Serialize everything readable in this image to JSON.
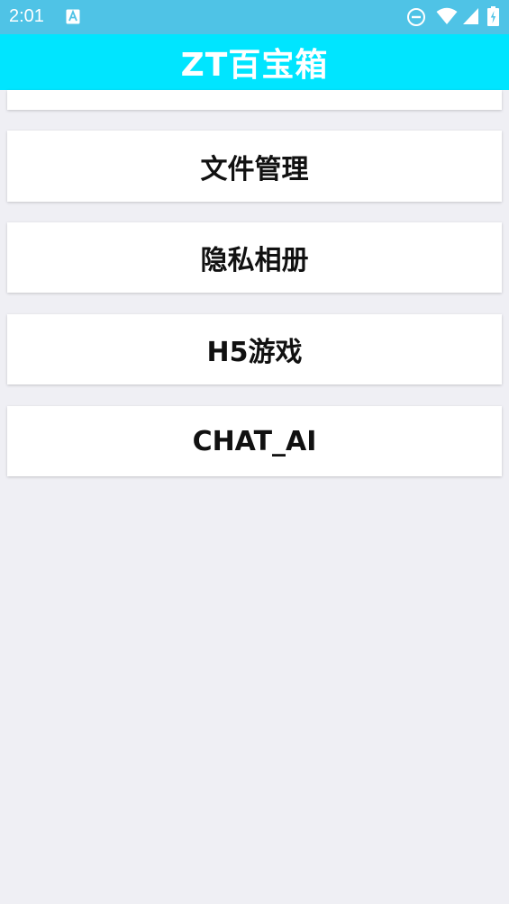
{
  "status_bar": {
    "time": "2:01",
    "icons": [
      "notification-a-icon",
      "do-not-disturb-icon",
      "wifi-icon",
      "cell-signal-icon",
      "battery-icon"
    ],
    "background": "#4fc3e6"
  },
  "app_bar": {
    "title": "ZT百宝箱",
    "background": "#00e5ff"
  },
  "menu": {
    "items": [
      {
        "label": "文件管理"
      },
      {
        "label": "隐私相册"
      },
      {
        "label": "H5游戏"
      },
      {
        "label": "CHAT_AI"
      }
    ]
  },
  "colors": {
    "page_background": "#efeff4",
    "card_background": "#ffffff"
  }
}
